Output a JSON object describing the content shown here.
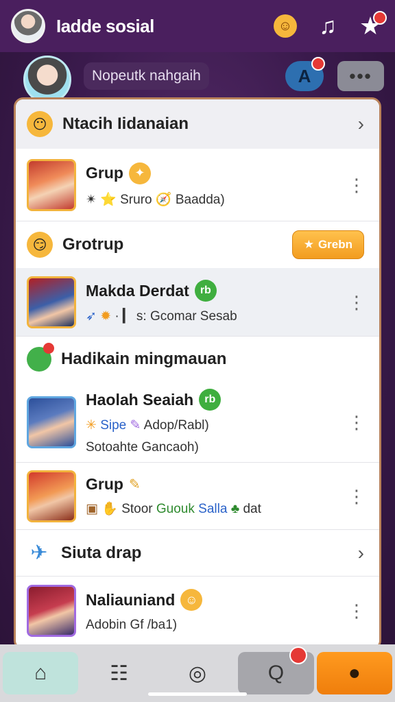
{
  "header": {
    "app_title": "Iadde sosial",
    "icons": [
      "avatar",
      "emoji-face-icon",
      "music-note-icon",
      "star-icon"
    ]
  },
  "subheader": {
    "search_text": "Nopeutk nahgaih",
    "font_button_label": "A",
    "more_button_label": "•••"
  },
  "sections": [
    {
      "title": "Ntacih Iidanaian",
      "rows": [
        {
          "title": "Grup",
          "subtitle_parts": [
            "⭐ Sruro",
            "🧭 Baadda)"
          ]
        }
      ]
    },
    {
      "title": "Grotrup",
      "action_label": "Grebn",
      "rows": [
        {
          "title": "Makda Derdat",
          "subtitle": "· ▎ s: Gcomar Sesab"
        }
      ]
    },
    {
      "title": "Hadikain mingmauan",
      "rows": [
        {
          "title": "Haolah Seaiah",
          "subtitle_blue": "Sipe",
          "subtitle_rest": "Adop/Rabl)",
          "subtitle2": "Sotoahte Gancaoh)"
        },
        {
          "title": "Grup",
          "subtitle_plain": "Stoor",
          "subtitle_green": "Guouk",
          "subtitle_blue": "Salla",
          "subtitle_tail": "dat"
        }
      ]
    },
    {
      "title": "Siuta drap",
      "rows": [
        {
          "title": "Naliauniand",
          "subtitle": "Adobin   Gf /ba1)"
        }
      ]
    }
  ],
  "bottom_nav": [
    "home-icon",
    "clipboard-icon",
    "chat-icon",
    "search-icon",
    "profile-icon"
  ],
  "colors": {
    "header_bg": "#4a1f5e",
    "card_border": "#b9825a",
    "accent_orange": "#f29c1f",
    "badge_green": "#3fae3f",
    "badge_gold": "#f6b73c"
  }
}
